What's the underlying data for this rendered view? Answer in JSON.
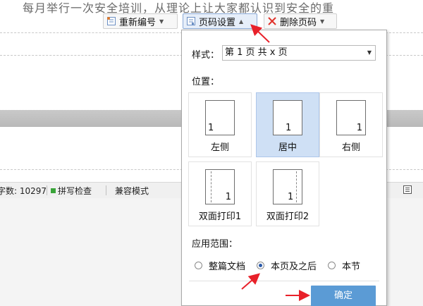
{
  "document": {
    "top_text": "每月举行一次安全培训，从理论上让大家都认识到安全的重"
  },
  "toolbar": {
    "renumber_label": "重新编号",
    "page_number_settings_label": "页码设置",
    "delete_page_number_label": "删除页码"
  },
  "status_bar": {
    "word_count": "字数: 10297",
    "spell_check": "拼写检查",
    "compat_mode": "兼容模式"
  },
  "dialog": {
    "style_label": "样式：",
    "style_value": "第 1 页 共 x 页",
    "position_label": "位置：",
    "positions": [
      {
        "caption": "左侧",
        "number": "1",
        "selected": false
      },
      {
        "caption": "居中",
        "number": "1",
        "selected": true
      },
      {
        "caption": "右侧",
        "number": "1",
        "selected": false
      },
      {
        "caption": "双面打印1",
        "number": "1",
        "selected": false
      },
      {
        "caption": "双面打印2",
        "number": "1",
        "selected": false
      }
    ],
    "scope_label": "应用范围：",
    "scope_options": [
      {
        "label": "整篇文档",
        "selected": false
      },
      {
        "label": "本页及之后",
        "selected": true
      },
      {
        "label": "本节",
        "selected": false
      }
    ],
    "ok_label": "确定"
  },
  "colors": {
    "accent": "#5b9bd5",
    "selected_card": "#cfe0f5",
    "annotation_arrow": "#e8212a"
  },
  "icons": [
    "renumber-icon",
    "page-number-icon",
    "delete-x-icon",
    "menu-lines-icon"
  ]
}
